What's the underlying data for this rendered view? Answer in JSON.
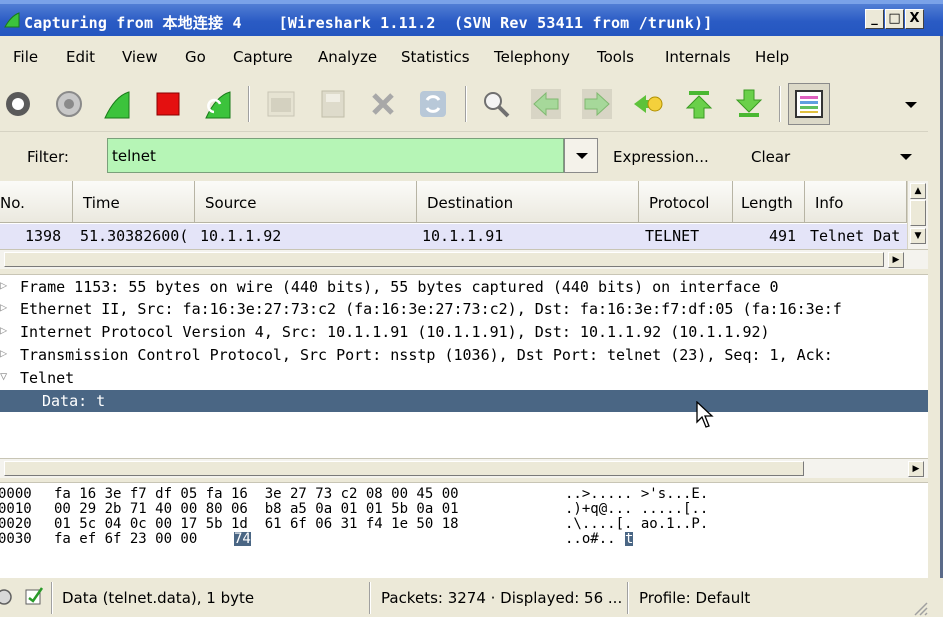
{
  "window": {
    "title": "Capturing from 本地连接 4    [Wireshark 1.11.2  (SVN Rev 53411 from /trunk)]",
    "minimize": "_",
    "maximize": "□",
    "close": "X"
  },
  "menu": {
    "file": "File",
    "edit": "Edit",
    "view": "View",
    "go": "Go",
    "capture": "Capture",
    "analyze": "Analyze",
    "statistics": "Statistics",
    "telephony": "Telephony",
    "tools": "Tools",
    "internals": "Internals",
    "help": "Help"
  },
  "toolbar": {
    "icons": [
      "stop-interface-icon",
      "capture-options-icon",
      "start-capture-icon",
      "stop-capture-icon",
      "restart-capture-icon",
      "open-file-icon",
      "save-file-icon",
      "close-file-icon",
      "reload-icon",
      "find-packet-icon",
      "go-back-icon",
      "go-forward-icon",
      "go-to-packet-icon",
      "go-first-icon",
      "go-last-icon",
      "colorize-icon",
      "more-icon"
    ]
  },
  "filter": {
    "label": "Filter:",
    "value": "telnet",
    "expression": "Expression...",
    "clear": "Clear"
  },
  "packet_list": {
    "columns": [
      "No.",
      "Time",
      "Source",
      "Destination",
      "Protocol",
      "Length",
      "Info"
    ],
    "rows": [
      {
        "no": "1398",
        "time": "51.30382600(",
        "source": "10.1.1.92",
        "destination": "10.1.1.91",
        "protocol": "TELNET",
        "length": "491",
        "info": "Telnet Dat"
      }
    ]
  },
  "details": {
    "lines": [
      "Frame 1153: 55 bytes on wire (440 bits), 55 bytes captured (440 bits) on interface 0",
      "Ethernet II, Src: fa:16:3e:27:73:c2 (fa:16:3e:27:73:c2), Dst: fa:16:3e:f7:df:05 (fa:16:3e:f",
      "Internet Protocol Version 4, Src: 10.1.1.91 (10.1.1.91), Dst: 10.1.1.92 (10.1.1.92)",
      "Transmission Control Protocol, Src Port: nsstp (1036), Dst Port: telnet (23), Seq: 1, Ack:",
      "Telnet"
    ],
    "selected": "Data: t"
  },
  "hex": {
    "rows": [
      {
        "offset": "0000",
        "bytes": "fa 16 3e f7 df 05 fa 16  3e 27 73 c2 08 00 45 00",
        "ascii": "..>..... >'s...E."
      },
      {
        "offset": "0010",
        "bytes": "00 29 2b 71 40 00 80 06  b8 a5 0a 01 01 5b 0a 01",
        "ascii": ".)+q@... .....[.."
      },
      {
        "offset": "0020",
        "bytes": "01 5c 04 0c 00 17 5b 1d  61 6f 06 31 f4 1e 50 18",
        "ascii": ".\\....[. ao.1..P."
      },
      {
        "offset": "0030",
        "bytes": "fa ef 6f 23 00 00",
        "sel_byte": "74",
        "ascii": "..o#..",
        "sel_ascii": "t"
      }
    ]
  },
  "status": {
    "field": "Data (telnet.data), 1 byte",
    "packets": "Packets: 3274 · Displayed: 56 ...",
    "profile": "Profile: Default"
  },
  "colors": {
    "title_bar": "#2a5bc4",
    "filter_valid": "#b6f5b6",
    "selected_row": "#4a6684",
    "packet_row": "#e4e4f8"
  }
}
